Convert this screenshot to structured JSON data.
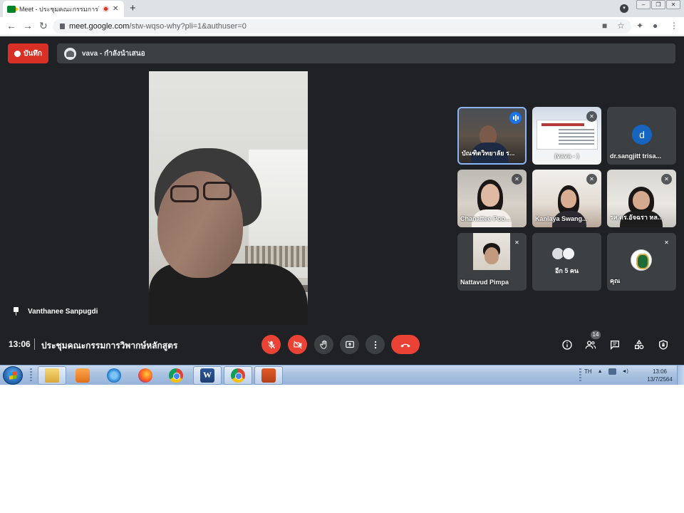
{
  "browser": {
    "tab_title": "Meet - ประชุมคณะกรรมการวิพากษ์",
    "tab_close": "✕",
    "new_tab": "+",
    "url_host": "meet.google.com",
    "url_path": "/stw-wqso-why?pli=1&authuser=0"
  },
  "meet": {
    "record_label": "บันทึก",
    "presenting_text": "vava - กำลังนำเสนอ",
    "pinned_name": "Vanthanee Sanpugdi",
    "tiles": [
      {
        "name": "บัณฑิตวิทยาลัย ร..."
      },
      {
        "name": "(vava - )"
      },
      {
        "name": "dr.sangjitt trisa...",
        "initial": "d"
      },
      {
        "name": "Chanattee Poo..."
      },
      {
        "name": "Kanlaya Swang..."
      },
      {
        "name": "รศ.ดร.อัจฉรา หล..."
      },
      {
        "name": "Nattavud Pimpa"
      },
      {
        "name": "อีก 5 คน"
      },
      {
        "name": "คุณ"
      }
    ],
    "clock": "13:06",
    "meeting_title": "ประชุมคณะกรรมการวิพากษ์หลักสูตร",
    "participant_count": "14"
  },
  "taskbar": {
    "lang": "TH",
    "time": "13:06",
    "date": "13/7/2564"
  },
  "colors": {
    "meet_bg": "#202124",
    "tile_bg": "#3c4043",
    "danger_red": "#ea4335",
    "active_blue": "#8ab4f8"
  }
}
